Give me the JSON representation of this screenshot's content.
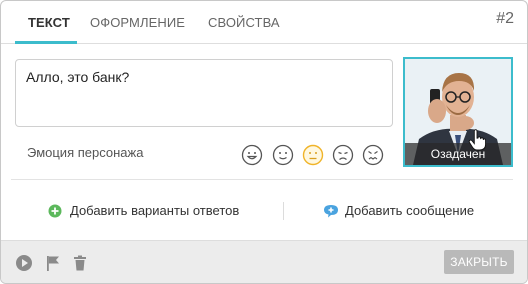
{
  "tabs": [
    {
      "label": "ТЕКСТ",
      "active": true
    },
    {
      "label": "ОФОРМЛЕНИЕ",
      "active": false
    },
    {
      "label": "СВОЙСТВА",
      "active": false
    }
  ],
  "slide_number": "#2",
  "message_text": "Алло, это банк?",
  "emotion": {
    "label": "Эмоция персонажа",
    "options": [
      "smile-icon",
      "neutral-smile-icon",
      "worried-icon",
      "sad-icon",
      "angry-icon"
    ],
    "selected": "worried-icon"
  },
  "character": {
    "caption": "Озадачен"
  },
  "actions": {
    "add_answers": "Добавить варианты ответов",
    "add_message": "Добавить сообщение"
  },
  "footer": {
    "close_label": "ЗАКРЫТЬ"
  },
  "colors": {
    "accent": "#3cbccc",
    "add_green": "#5cb85c",
    "add_blue": "#4aa3df",
    "selected_face": "#f0b429"
  }
}
